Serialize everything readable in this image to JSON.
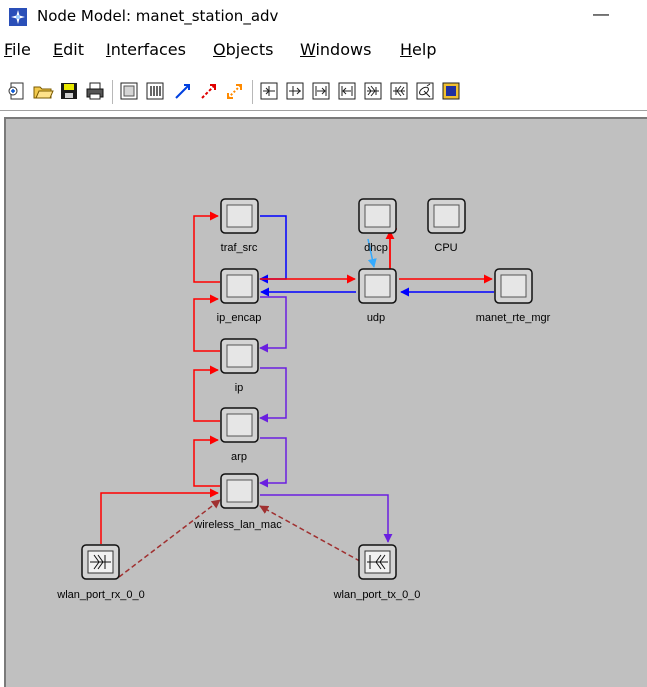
{
  "window": {
    "title": "Node Model: manet_station_adv",
    "minimize_glyph": "—"
  },
  "menu": [
    {
      "key": "file",
      "label": "File",
      "mnemonic": "F",
      "rest": "ile"
    },
    {
      "key": "edit",
      "label": "Edit",
      "mnemonic": "E",
      "rest": "dit"
    },
    {
      "key": "interfaces",
      "label": "Interfaces",
      "mnemonic": "I",
      "rest": "nterfaces"
    },
    {
      "key": "objects",
      "label": "Objects",
      "mnemonic": "O",
      "rest": "bjects"
    },
    {
      "key": "windows",
      "label": "Windows",
      "mnemonic": "W",
      "rest": "indows"
    },
    {
      "key": "help",
      "label": "Help",
      "mnemonic": "H",
      "rest": "elp"
    }
  ],
  "toolbar": {
    "buttons": [
      "new-module-icon",
      "open-folder-icon",
      "save-icon",
      "print-icon",
      "create-processor-icon",
      "create-queue-icon",
      "packet-stream-icon",
      "stat-wire-icon",
      "logical-association-icon",
      "point-to-point-rx-icon",
      "point-to-point-tx-icon",
      "bus-rx-icon",
      "bus-tx-icon",
      "radio-rx-icon",
      "radio-tx-icon",
      "antenna-icon",
      "external-system-icon"
    ]
  },
  "nodes": {
    "traf_src": {
      "label": "traf_src"
    },
    "ip_encap": {
      "label": "ip_encap"
    },
    "ip": {
      "label": "ip"
    },
    "arp": {
      "label": "arp"
    },
    "wireless_lan_mac": {
      "label": "wireless_lan_mac"
    },
    "dhcp": {
      "label": "dhcp"
    },
    "cpu": {
      "label": "CPU"
    },
    "udp": {
      "label": "udp"
    },
    "manet_rte_mgr": {
      "label": "manet_rte_mgr"
    },
    "wlan_port_rx_0_0": {
      "label": "wlan_port_rx_0_0"
    },
    "wlan_port_tx_0_0": {
      "label": "wlan_port_tx_0_0"
    }
  },
  "colors": {
    "canvas": "#c0c0c0",
    "stream_red": "#ff0000",
    "stream_blue": "#0000ff",
    "stream_purple": "#6a1fe0",
    "stream_lightblue": "#33aaff",
    "association_dashed": "#a03030",
    "node_fill": "#d4d4d4"
  }
}
